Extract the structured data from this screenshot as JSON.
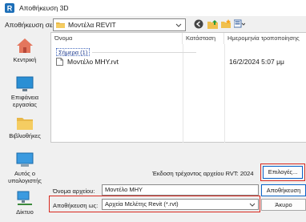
{
  "window": {
    "title": "Αποθήκευση 3D"
  },
  "lookin": {
    "label": "Αποθήκευση σε:",
    "value": "Μοντέλα REVIT"
  },
  "places": [
    {
      "label": "Κεντρική"
    },
    {
      "label": "Επιφάνεια εργασίας"
    },
    {
      "label": "Βιβλιοθήκες"
    },
    {
      "label": "Αυτός ο υπολογιστής"
    },
    {
      "label": "Δίκτυο"
    }
  ],
  "columns": {
    "name": "Όνομα",
    "status": "Κατάσταση",
    "modified": "Ημερομηνία τροποποίησης"
  },
  "group": {
    "label": "Σήμερα (1)"
  },
  "files": [
    {
      "name": "Μοντέλο ΜΗΥ.rvt",
      "modified": "16/2/2024 5:07 μμ"
    }
  ],
  "version_label": "Έκδοση τρέχοντος αρχείου RVT: 2024",
  "options_button": "Επιλογές...",
  "filename": {
    "label": "Όνομα αρχείου:",
    "value": "Μοντέλο ΜΗΥ"
  },
  "savetype": {
    "label": "Αποθήκευση ως:",
    "value": "Αρχεία Μελέτης Revit (*.rvt)"
  },
  "save_button": "Αποθήκευση",
  "cancel_button": "Άκυρο",
  "colors": {
    "accent": "#0a64c8",
    "highlight": "#d8281e"
  }
}
